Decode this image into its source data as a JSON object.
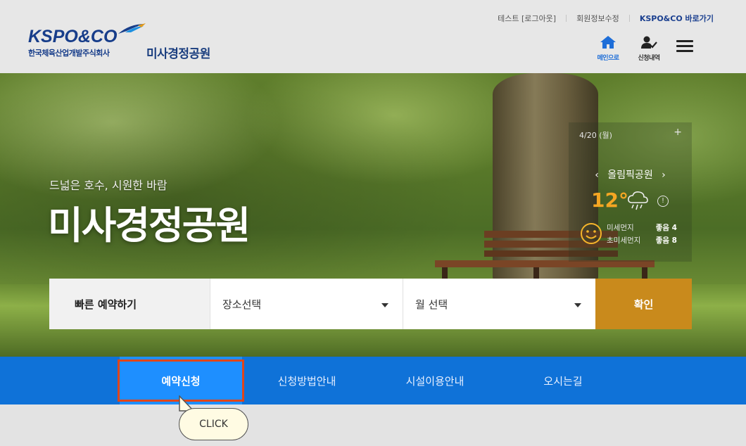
{
  "header": {
    "logo_text": "KSPO&CO",
    "logo_subtitle": "한국체육산업개발주식회사",
    "site_title": "미사경정공원",
    "top_links": [
      "테스트 [로그아웃]",
      "회원정보수정",
      "KSPO&CO 바로가기"
    ],
    "home_label": "메인으로",
    "history_label": "신청내역"
  },
  "hero": {
    "subtitle": "드넓은 호수, 시원한 바람",
    "title": "미사경정공원"
  },
  "weather": {
    "date": "4/20 (월)",
    "plus": "+",
    "location": "올림픽공원",
    "prev": "‹",
    "next": "›",
    "temperature": "12°",
    "rows": [
      {
        "label": "미세먼지",
        "value": "좋음 4"
      },
      {
        "label": "초미세먼지",
        "value": "좋음 8"
      }
    ]
  },
  "booking": {
    "label": "빠른 예약하기",
    "place_select": "장소선택",
    "month_select": "월 선택",
    "confirm": "확인"
  },
  "nav": {
    "items": [
      "예약신청",
      "신청방법안내",
      "시설이용안내",
      "오시는길"
    ]
  },
  "tooltip": {
    "text": "CLICK"
  },
  "colors": {
    "brand_navy": "#173d8a",
    "nav_blue": "#0f72d8",
    "nav_active": "#1e8fff",
    "confirm_orange": "#c98a1c",
    "highlight_red": "#e0451a",
    "temp_orange": "#f5a623"
  }
}
